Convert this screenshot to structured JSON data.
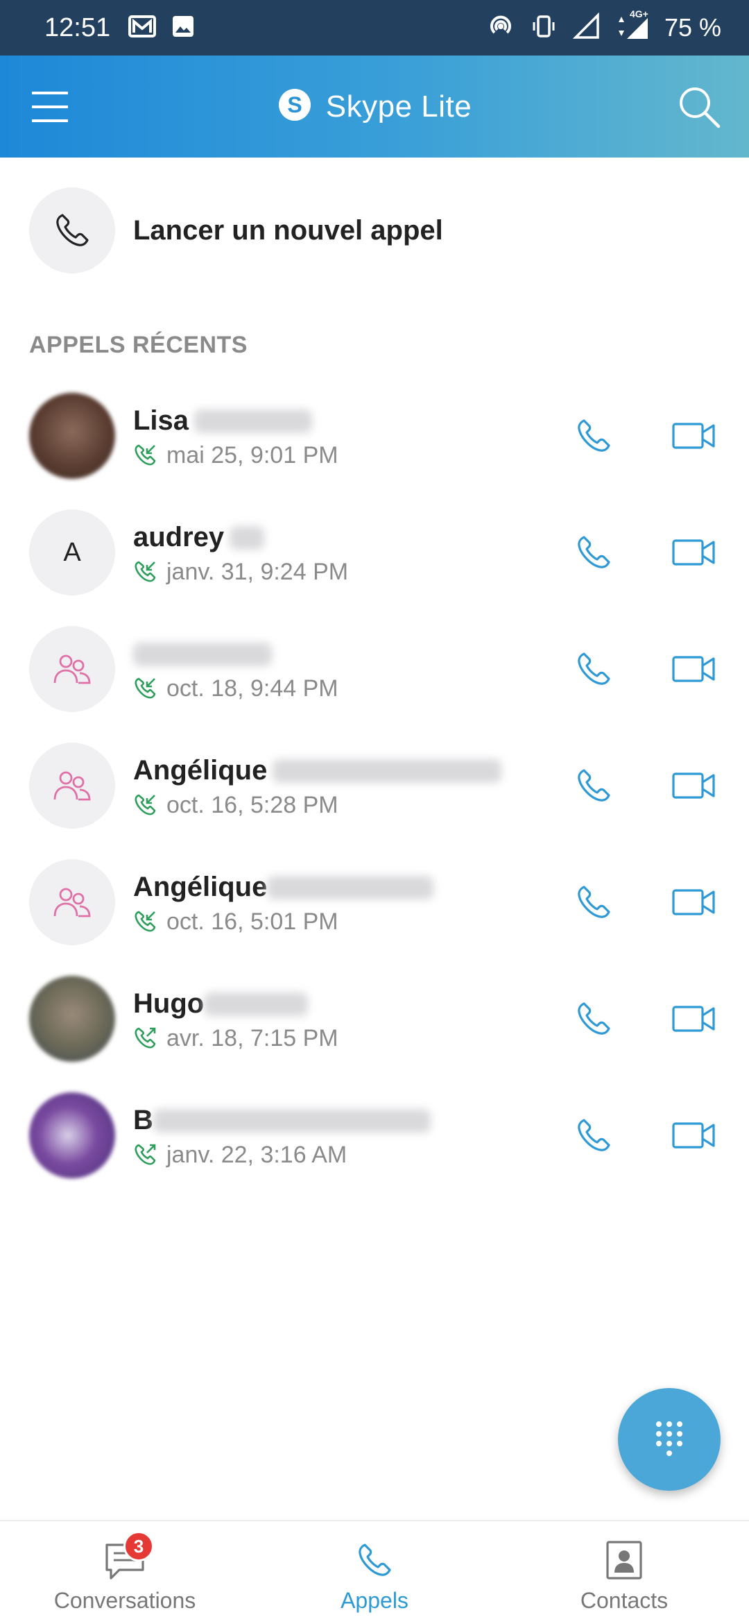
{
  "status_bar": {
    "time": "12:51",
    "battery": "75 %",
    "network": "4G+"
  },
  "app_bar": {
    "title": "Skype Lite"
  },
  "new_call": {
    "label": "Lancer un nouvel appel"
  },
  "recent": {
    "section_title": "APPELS RÉCENTS",
    "calls": [
      {
        "name": "Lisa",
        "date": "mai 25, 9:01 PM",
        "direction": "incoming",
        "avatar": "photo"
      },
      {
        "name": "audrey",
        "date": "janv. 31, 9:24 PM",
        "direction": "incoming",
        "avatar": "initial",
        "initial": "A"
      },
      {
        "name": "",
        "date": "oct. 18, 9:44 PM",
        "direction": "incoming",
        "avatar": "group"
      },
      {
        "name": "Angélique",
        "date": "oct. 16, 5:28 PM",
        "direction": "incoming",
        "avatar": "group"
      },
      {
        "name": "Angélique",
        "date": "oct. 16, 5:01 PM",
        "direction": "incoming",
        "avatar": "group"
      },
      {
        "name": "Hugo",
        "date": "avr. 18, 7:15 PM",
        "direction": "outgoing",
        "avatar": "photo"
      },
      {
        "name": "B",
        "date": "janv. 22, 3:16 AM",
        "direction": "outgoing",
        "avatar": "photo"
      }
    ]
  },
  "bottom_nav": {
    "conversations": "Conversations",
    "conversations_badge": "3",
    "calls": "Appels",
    "contacts": "Contacts"
  },
  "colors": {
    "status_bar": "#23415f",
    "accent": "#2d9ad6",
    "call_arrow": "#2e9e5b",
    "group_icon": "#e070a8",
    "badge": "#e53935"
  }
}
